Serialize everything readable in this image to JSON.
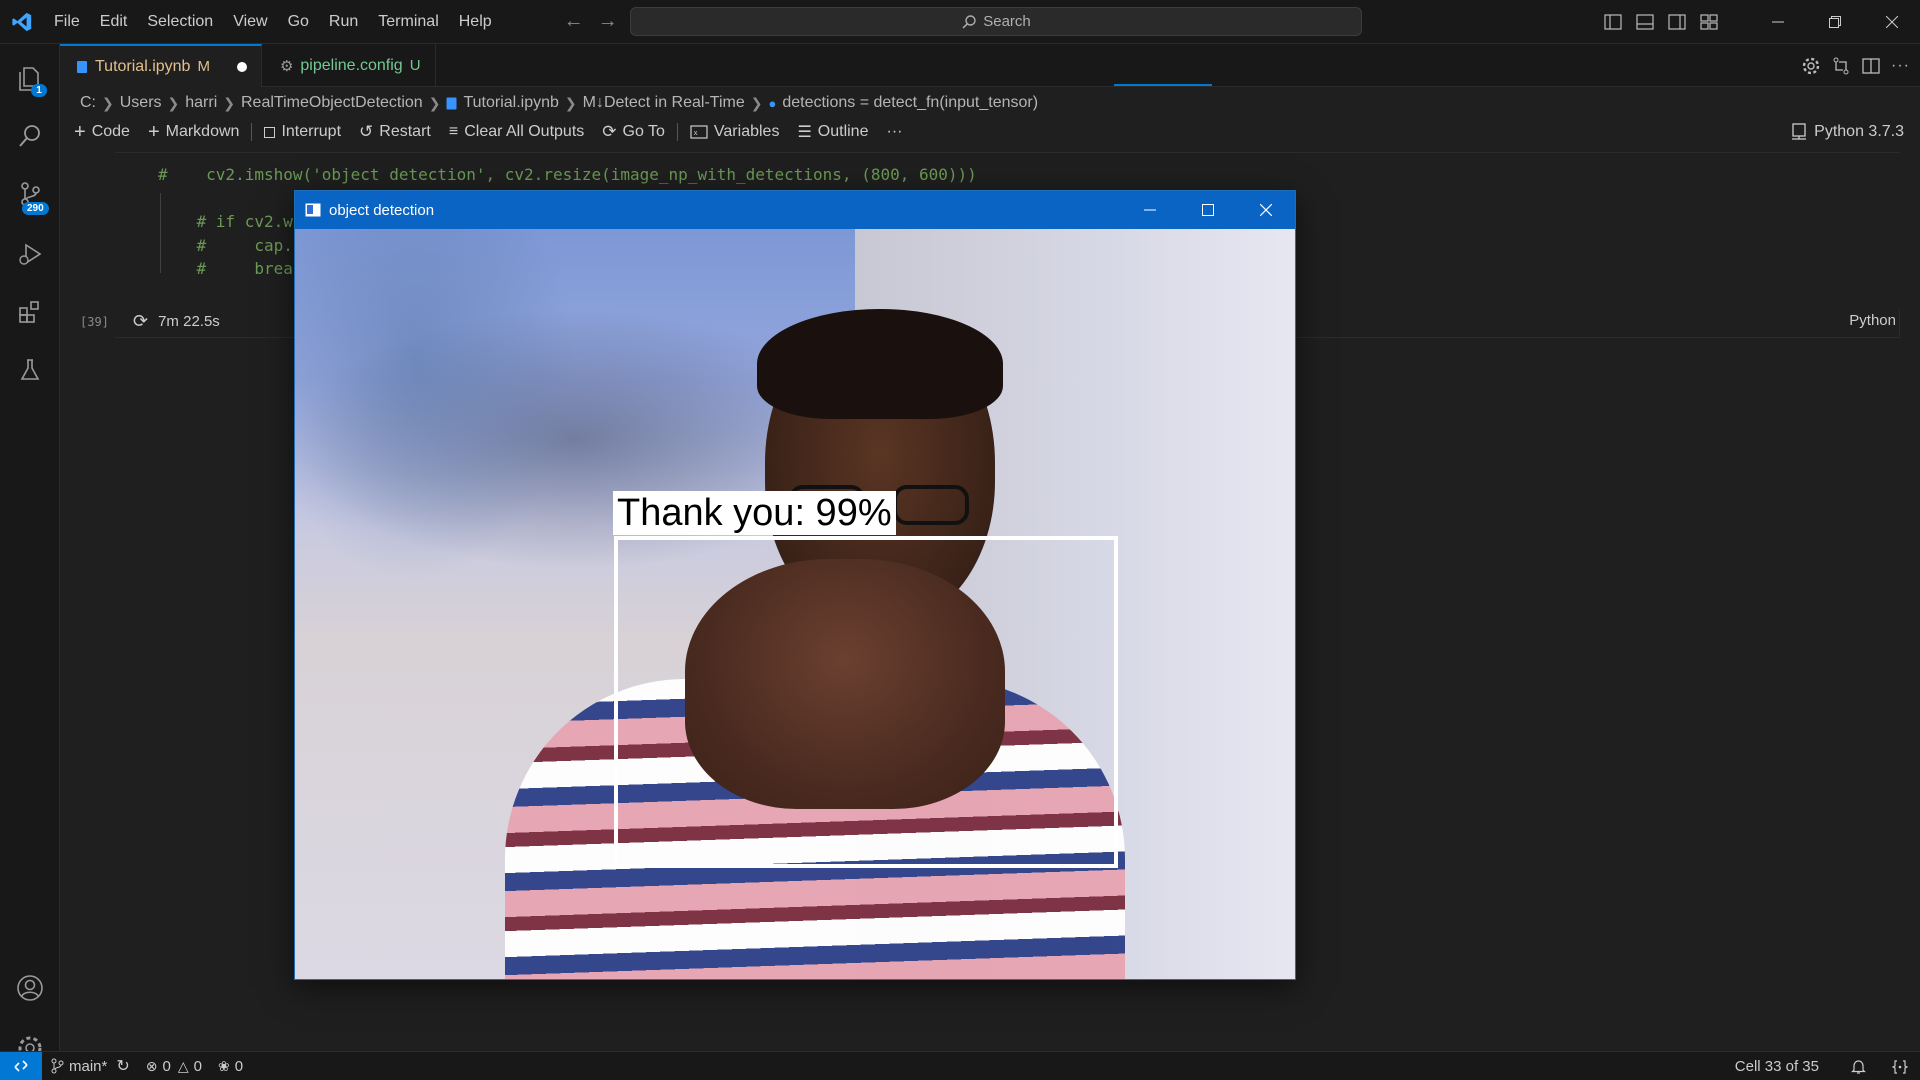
{
  "titlebar": {
    "menu": [
      "File",
      "Edit",
      "Selection",
      "View",
      "Go",
      "Run",
      "Terminal",
      "Help"
    ],
    "search_placeholder": "Search"
  },
  "activity": {
    "explorer_badge": "1",
    "scm_badge": "290"
  },
  "tabs": [
    {
      "label": "Tutorial.ipynb",
      "status": "M",
      "active": true,
      "color": "#e2c08d"
    },
    {
      "label": "pipeline.config",
      "status": "U",
      "active": false,
      "color": "#73c991"
    }
  ],
  "breadcrumb": [
    "C:",
    "Users",
    "harri",
    "RealTimeObjectDetection",
    "Tutorial.ipynb",
    "M↓Detect in Real-Time",
    "detections = detect_fn(input_tensor)"
  ],
  "notebook_toolbar": {
    "code": "Code",
    "markdown": "Markdown",
    "interrupt": "Interrupt",
    "restart": "Restart",
    "clear_all": "Clear All Outputs",
    "goto": "Go To",
    "variables": "Variables",
    "outline": "Outline",
    "more": "···",
    "kernel": "Python 3.7.3"
  },
  "cell": {
    "lines": [
      "#    cv2.imshow('object detection', cv2.resize(image_np_with_detections, (800, 600)))",
      "    # if cv2.w",
      "    #     cap.",
      "    #     brea"
    ],
    "exec_count": "[39]",
    "duration": "7m 22.5s",
    "language": "Python"
  },
  "cv_window": {
    "title": "object detection",
    "detection_label": "Thank you: 99%"
  },
  "statusbar": {
    "branch": "main*",
    "errors": "0",
    "warnings": "0",
    "ports": "0",
    "cell_position": "Cell 33 of 35"
  },
  "colors": {
    "accent": "#0078d4",
    "code_comment": "#6a9955",
    "modified": "#e2c08d",
    "untracked": "#73c991"
  }
}
